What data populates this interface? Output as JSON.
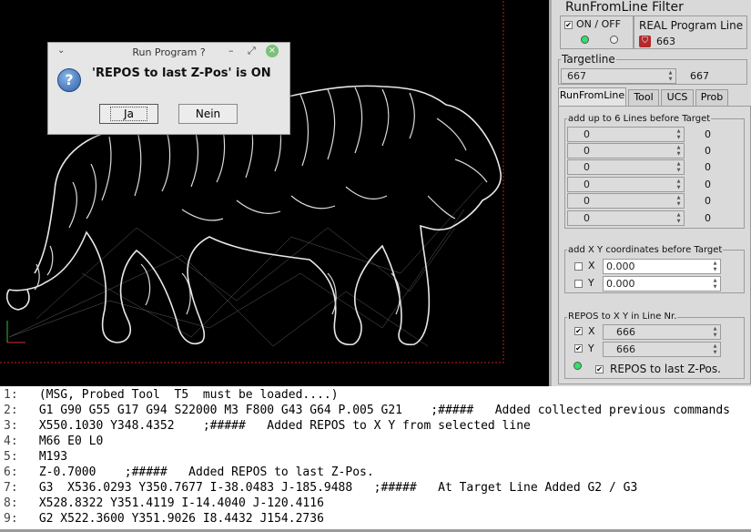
{
  "dialog": {
    "title": "Run Program ?",
    "menu_glyph": "⌄",
    "min_glyph": "–",
    "max_glyph": "⤢",
    "close_glyph": "×",
    "message": "'REPOS to last Z-Pos' is ON",
    "icon_glyph": "?",
    "yes_label": "Ja",
    "no_label": "Nein"
  },
  "panel": {
    "title": "RunFromLine Filter",
    "onoff_label": "ON / OFF",
    "onoff_checked_glyph": "✔",
    "real_program_line_label": "REAL Program Line",
    "real_program_line_value": "663",
    "targetline_label": "Targetline",
    "targetline_input": "667",
    "targetline_value": "667",
    "tabs": [
      {
        "label": "RunFromLine",
        "active": true
      },
      {
        "label": "Tool",
        "active": false
      },
      {
        "label": "UCS",
        "active": false
      },
      {
        "label": "Prob",
        "active": false
      }
    ],
    "lines_before_label": "add up to 6 Lines before Target",
    "lines_before": [
      {
        "input": "0",
        "value": "0"
      },
      {
        "input": "0",
        "value": "0"
      },
      {
        "input": "0",
        "value": "0"
      },
      {
        "input": "0",
        "value": "0"
      },
      {
        "input": "0",
        "value": "0"
      },
      {
        "input": "0",
        "value": "0"
      }
    ],
    "xy_before_label": "add X Y coordinates before Target",
    "x_label": "X",
    "x_value": "0.000",
    "y_label": "Y",
    "y_value": "0.000",
    "repos_label": "REPOS to  X Y  in Line Nr.",
    "repos_x_label": "X",
    "repos_x_value": "666",
    "repos_y_label": "Y",
    "repos_y_value": "666",
    "repos_z_label": "REPOS to last Z-Pos.",
    "check_glyph": "✔",
    "spin_up": "▲",
    "spin_down": "▼",
    "led_on_color": "#2ee26a",
    "accent_red": "#b22a2a"
  },
  "gcode": [
    {
      "n": "1:",
      "text": " (MSG, Probed Tool  T5  must be loaded....)"
    },
    {
      "n": "2:",
      "text": " G1 G90 G55 G17 G94 S22000 M3 F800 G43 G64 P.005 G21    ;#####   Added collected previous commands"
    },
    {
      "n": "3:",
      "text": " X550.1030 Y348.4352    ;#####   Added REPOS to X Y from selected line"
    },
    {
      "n": "4:",
      "text": " M66 E0 L0"
    },
    {
      "n": "5:",
      "text": " M193"
    },
    {
      "n": "6:",
      "text": " Z-0.7000    ;#####   Added REPOS to last Z-Pos."
    },
    {
      "n": "7:",
      "text": " G3  X536.0293 Y350.7677 I-38.0483 J-185.9488   ;#####   At Target Line Added G2 / G3"
    },
    {
      "n": "8:",
      "text": " X528.8322 Y351.4119 I-14.4040 J-120.4116"
    },
    {
      "n": "9:",
      "text": " G2 X522.3600 Y351.9026 I8.4432 J154.2736"
    }
  ]
}
